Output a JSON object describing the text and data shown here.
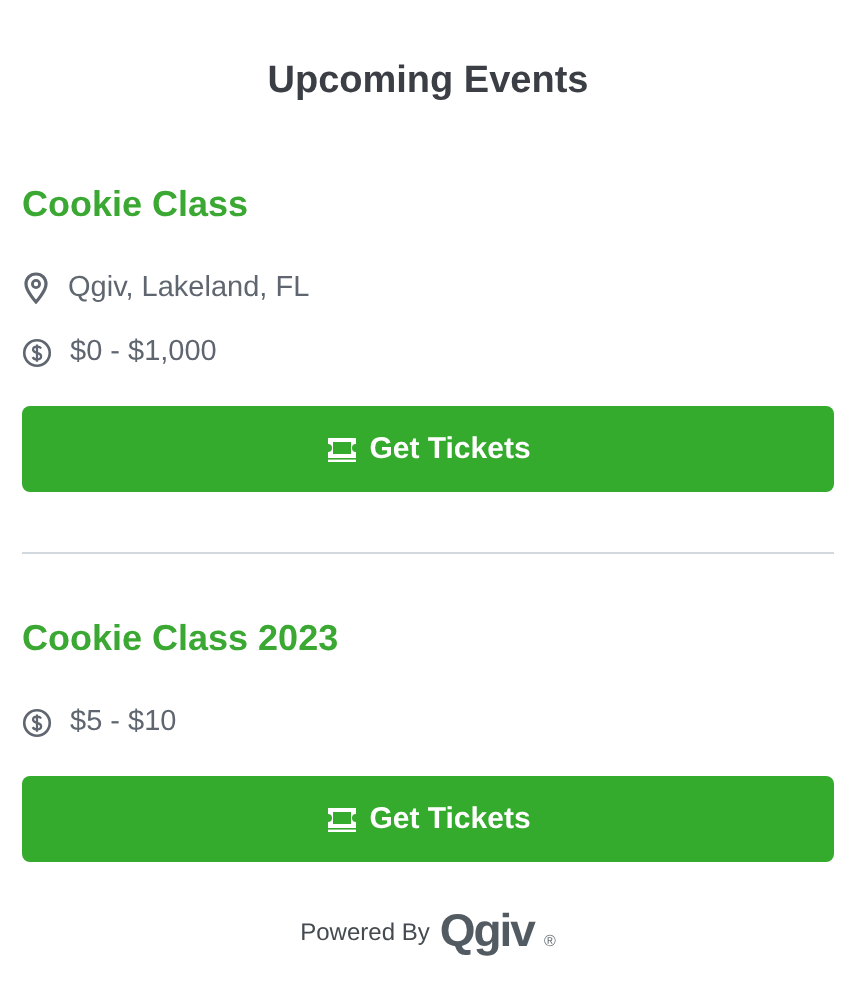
{
  "title": "Upcoming Events",
  "events": [
    {
      "name": "Cookie Class",
      "details": [
        {
          "kind": "location",
          "text": "Qgiv, Lakeland, FL"
        },
        {
          "kind": "price",
          "text": "$0 - $1,000"
        }
      ],
      "button": "Get Tickets"
    },
    {
      "name": "Cookie Class 2023",
      "details": [
        {
          "kind": "price",
          "text": "$5 - $10"
        }
      ],
      "button": "Get Tickets"
    }
  ],
  "footer": {
    "label": "Powered By",
    "logo": "Qgiv",
    "mark": "®"
  }
}
